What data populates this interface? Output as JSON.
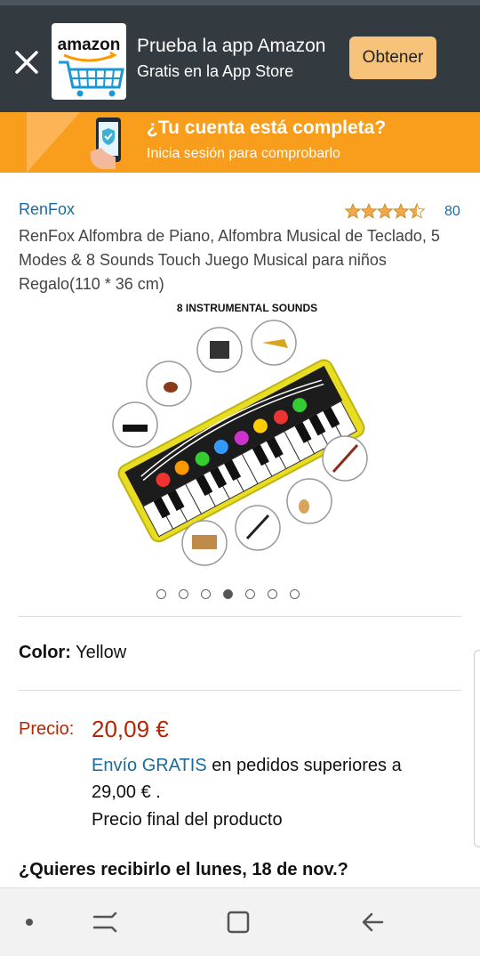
{
  "banner": {
    "logo_text": "amazon",
    "title": "Prueba la app Amazon",
    "subtitle": "Gratis en la App Store",
    "get_button": "Obtener"
  },
  "promo": {
    "title": "¿Tu cuenta está completa?",
    "subtitle": "Inicia sesión para comprobarlo"
  },
  "product": {
    "brand": "RenFox",
    "rating_stars": 4.5,
    "rating_count": "80",
    "title": "RenFox Alfombra de Piano, Alfombra Musical de Teclado, 5 Modes & 8 Sounds Touch Juego Musical para niños Regalo(110 * 36 cm)",
    "image_caption": "8 INSTRUMENTAL SOUNDS",
    "carousel": {
      "total": 7,
      "active": 4
    }
  },
  "color": {
    "label": "Color:",
    "value": "Yellow"
  },
  "price": {
    "label": "Precio:",
    "value": "20,09 €",
    "shipping_link": "Envío GRATIS",
    "shipping_rest": " en pedidos superiores a 29,00 € .",
    "final_note": "Precio final del producto"
  },
  "delivery": {
    "title": "¿Quieres recibirlo el lunes, 18 de nov.?"
  },
  "colors": {
    "banner_bg": "#333a40",
    "promo_bg": "#f99d1c",
    "get_btn": "#f7c37a",
    "price": "#b12704",
    "link": "#1a6b9e"
  }
}
